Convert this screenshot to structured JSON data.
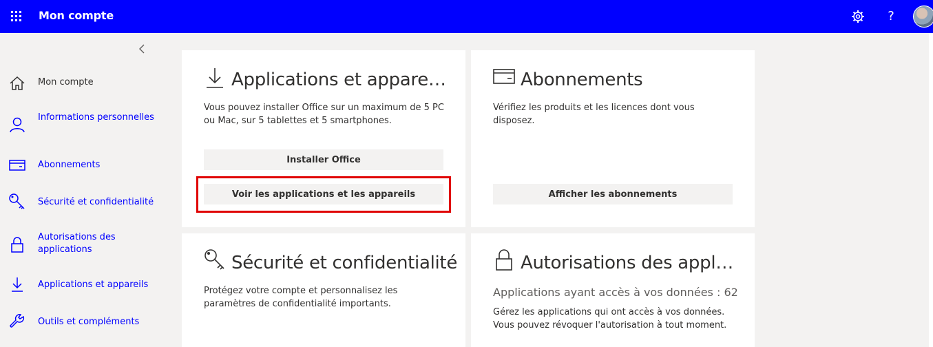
{
  "header": {
    "title": "Mon compte",
    "help_label": "?",
    "bg_color": "#0000ff"
  },
  "sidebar": {
    "items": [
      {
        "label": "Mon compte",
        "icon": "home-icon"
      },
      {
        "label": "Informations personnelles",
        "icon": "person-icon"
      },
      {
        "label": "Abonnements",
        "icon": "card-icon"
      },
      {
        "label": "Sécurité et confidentialité",
        "icon": "key-icon"
      },
      {
        "label": "Autorisations des applications",
        "icon": "lock-icon"
      },
      {
        "label": "Applications et appareils",
        "icon": "download-icon"
      },
      {
        "label": "Outils et compléments",
        "icon": "wrench-icon"
      }
    ]
  },
  "cards": {
    "apps": {
      "title": "Applications et appareil…",
      "desc": "Vous pouvez installer Office sur un maximum de 5 PC ou Mac, sur 5 tablettes et 5 smartphones.",
      "btn_install": "Installer Office",
      "btn_view": "Voir les applications et les appareils"
    },
    "subs": {
      "title": "Abonnements",
      "desc": "Vérifiez les produits et les licences dont vous disposez.",
      "btn_view": "Afficher les abonnements"
    },
    "security": {
      "title": "Sécurité et confidentialité",
      "desc": "Protégez votre compte et personnalisez les paramètres de confidentialité importants."
    },
    "perms": {
      "title": "Autorisations des appli…",
      "subtitle": "Applications ayant accès à vos données : 62",
      "desc": "Gérez les applications qui ont accès à vos données. Vous pouvez révoquer l'autorisation à tout moment."
    }
  },
  "colors": {
    "accent": "#0000ff",
    "highlight": "#e00000"
  }
}
